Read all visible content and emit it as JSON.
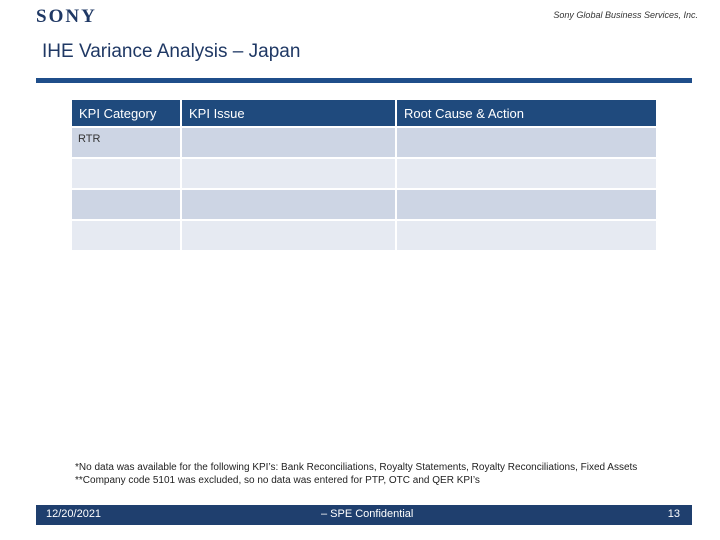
{
  "header": {
    "logo": "SONY",
    "company": "Sony Global Business Services, Inc."
  },
  "title": "IHE Variance Analysis – Japan",
  "table": {
    "columns": [
      "KPI Category",
      "KPI Issue",
      "Root Cause & Action"
    ],
    "rows": [
      [
        "RTR",
        "",
        ""
      ],
      [
        "",
        "",
        ""
      ],
      [
        "",
        "",
        ""
      ],
      [
        "",
        "",
        ""
      ]
    ]
  },
  "footnotes": {
    "line1": "*No data was available for the following KPI’s: Bank Reconciliations, Royalty Statements, Royalty Reconciliations, Fixed Assets",
    "line2": "**Company code 5101 was excluded, so no data was entered for PTP, OTC and QER KPI’s"
  },
  "footer": {
    "date": "12/20/2021",
    "confidential": "– SPE Confidential",
    "page": "13"
  }
}
